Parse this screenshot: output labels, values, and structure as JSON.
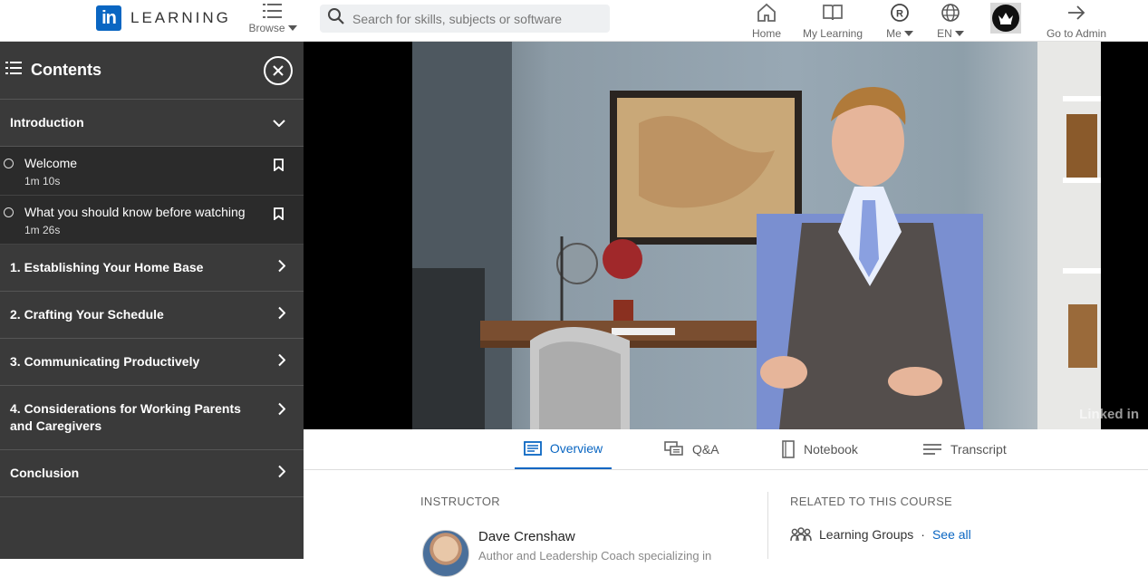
{
  "topnav": {
    "logo_mark": "in",
    "logo_text": "LEARNING",
    "browse_label": "Browse",
    "search_placeholder": "Search for skills, subjects or software",
    "items": [
      {
        "label": "Home",
        "icon": "home-icon"
      },
      {
        "label": "My Learning",
        "icon": "book-icon"
      },
      {
        "label": "Me",
        "icon": "profile-badge-icon"
      },
      {
        "label": "EN",
        "icon": "globe-icon"
      },
      {
        "label": "Go to Admin",
        "icon": "arrow-right-icon"
      }
    ]
  },
  "sidebar": {
    "title": "Contents",
    "sections": [
      {
        "title": "Introduction",
        "expanded": true,
        "videos": [
          {
            "title": "Welcome",
            "duration": "1m 10s"
          },
          {
            "title": "What you should know before watching",
            "duration": "1m 26s"
          }
        ]
      },
      {
        "title": "1. Establishing Your Home Base",
        "expanded": false
      },
      {
        "title": "2. Crafting Your Schedule",
        "expanded": false
      },
      {
        "title": "3. Communicating Productively",
        "expanded": false
      },
      {
        "title": "4. Considerations for Working Parents and Caregivers",
        "expanded": false
      },
      {
        "title": "Conclusion",
        "expanded": false
      }
    ]
  },
  "video": {
    "watermark": "Linked in"
  },
  "tabs": [
    {
      "label": "Overview",
      "active": true
    },
    {
      "label": "Q&A",
      "active": false
    },
    {
      "label": "Notebook",
      "active": false
    },
    {
      "label": "Transcript",
      "active": false
    }
  ],
  "overview": {
    "instructor_heading": "INSTRUCTOR",
    "instructor_name": "Dave Crenshaw",
    "instructor_bio": "Author and Leadership Coach specializing in",
    "related_heading": "RELATED TO THIS COURSE",
    "learning_groups_label": "Learning Groups",
    "separator": "·",
    "see_all_label": "See all"
  },
  "colors": {
    "brand": "#0a66c2",
    "sidebar_bg": "#3a3a3a",
    "sidebar_video_bg": "#2b2b2b"
  }
}
